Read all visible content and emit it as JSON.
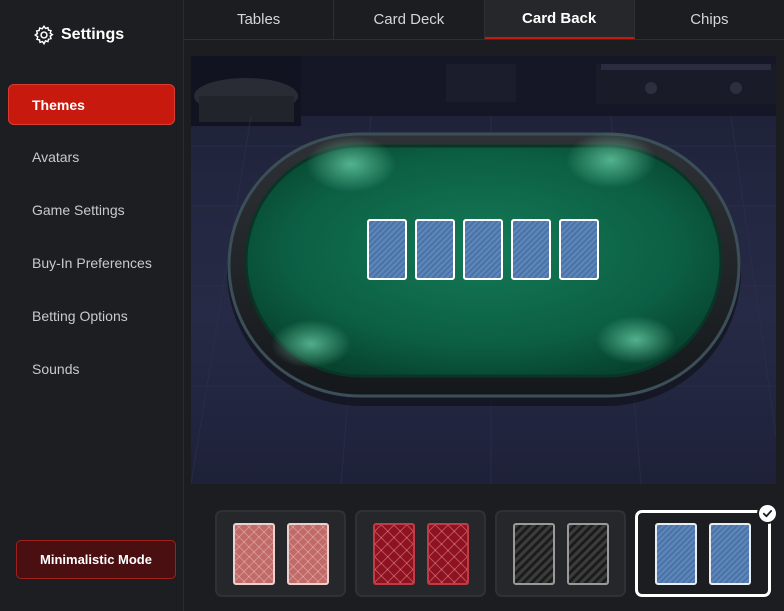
{
  "sidebar": {
    "title": "Settings",
    "icon": "gear-icon",
    "items": [
      {
        "label": "Themes",
        "active": true
      },
      {
        "label": "Avatars",
        "active": false
      },
      {
        "label": "Game Settings",
        "active": false
      },
      {
        "label": "Buy-In Preferences",
        "active": false
      },
      {
        "label": "Betting Options",
        "active": false
      },
      {
        "label": "Sounds",
        "active": false
      }
    ],
    "mode_button": "Minimalistic Mode"
  },
  "tabs": [
    {
      "label": "Tables",
      "active": false
    },
    {
      "label": "Card Deck",
      "active": false
    },
    {
      "label": "Card Back",
      "active": true
    },
    {
      "label": "Chips",
      "active": false
    }
  ],
  "preview": {
    "table_cards": 5,
    "felt_color": "#0f6b4a"
  },
  "card_backs": [
    {
      "name": "rose",
      "selected": false
    },
    {
      "name": "maroon",
      "selected": false
    },
    {
      "name": "chevron",
      "selected": false
    },
    {
      "name": "blue",
      "selected": true
    }
  ],
  "colors": {
    "accent": "#c8190f",
    "background": "#1c1d20",
    "selected_border": "#ffffff"
  }
}
